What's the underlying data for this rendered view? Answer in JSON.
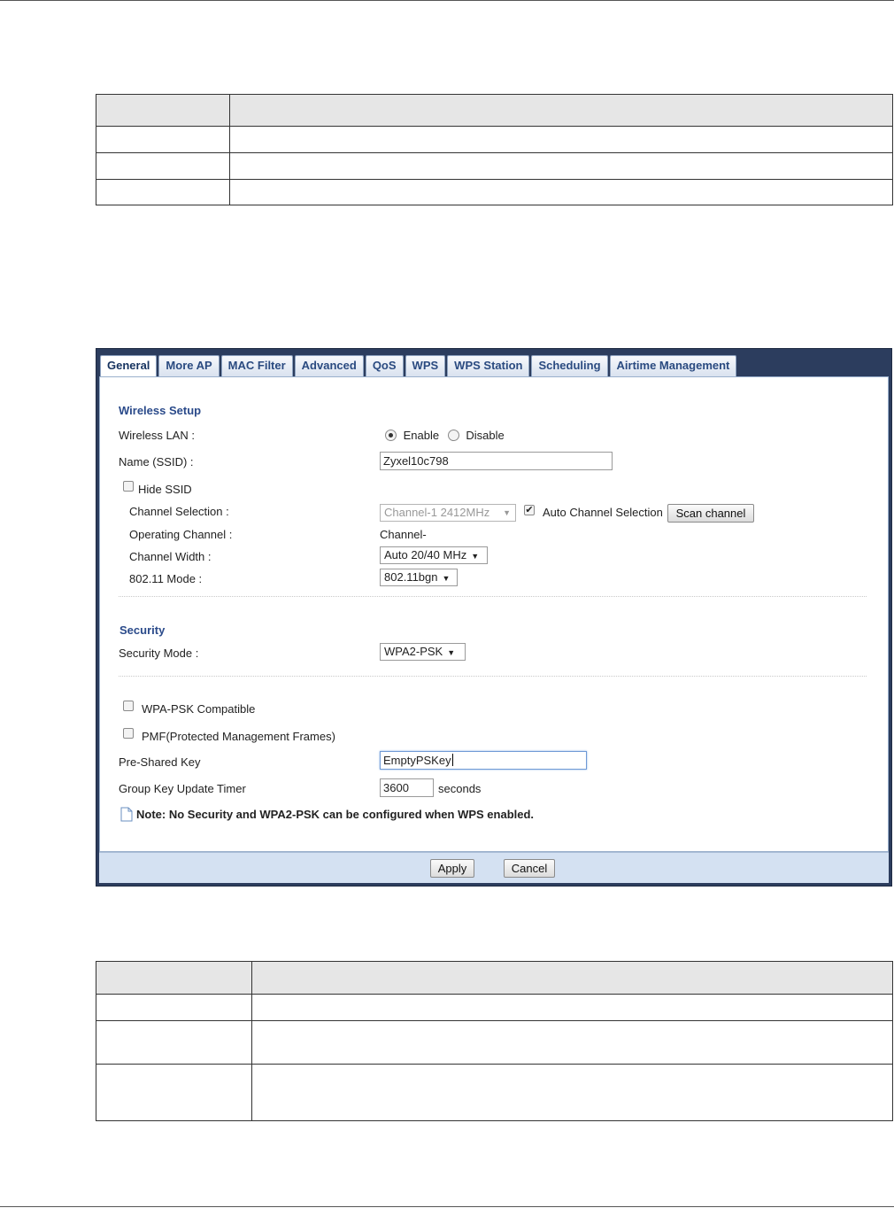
{
  "tabs": [
    {
      "label": "General",
      "active": true
    },
    {
      "label": "More AP"
    },
    {
      "label": "MAC Filter"
    },
    {
      "label": "Advanced"
    },
    {
      "label": "QoS"
    },
    {
      "label": "WPS"
    },
    {
      "label": "WPS Station"
    },
    {
      "label": "Scheduling"
    },
    {
      "label": "Airtime Management"
    }
  ],
  "wireless_setup": {
    "title": "Wireless Setup",
    "wireless_lan_label": "Wireless LAN :",
    "enable_label": "Enable",
    "disable_label": "Disable",
    "wireless_lan_value": "Enable",
    "ssid_label": "Name (SSID) :",
    "ssid_value": "Zyxel10c798",
    "hide_ssid_label": "Hide SSID",
    "hide_ssid_checked": false,
    "channel_selection_label": "Channel Selection :",
    "channel_selection_value": "Channel-1 2412MHz",
    "auto_channel_label": "Auto Channel Selection",
    "auto_channel_checked": true,
    "scan_channel_label": "Scan channel",
    "operating_channel_label": "Operating Channel :",
    "operating_channel_value": "Channel-",
    "channel_width_label": "Channel Width :",
    "channel_width_value": "Auto 20/40 MHz",
    "mode_label": "802.11 Mode :",
    "mode_value": "802.11bgn"
  },
  "security": {
    "title": "Security",
    "mode_label": "Security Mode :",
    "mode_value": "WPA2-PSK",
    "wpa_psk_compat_label": "WPA-PSK Compatible",
    "wpa_psk_compat_checked": false,
    "pmf_label": "PMF(Protected Management Frames)",
    "pmf_checked": false,
    "psk_label": "Pre-Shared Key",
    "psk_value": "EmptyPSKey",
    "timer_label": "Group Key Update Timer",
    "timer_value": "3600",
    "timer_unit": "seconds",
    "note": "Note: No Security and WPA2-PSK can be configured when WPS enabled."
  },
  "footer": {
    "apply_label": "Apply",
    "cancel_label": "Cancel"
  },
  "doc_tables": {
    "top": {
      "rows": 4
    },
    "bottom": {
      "rows": 4
    }
  }
}
